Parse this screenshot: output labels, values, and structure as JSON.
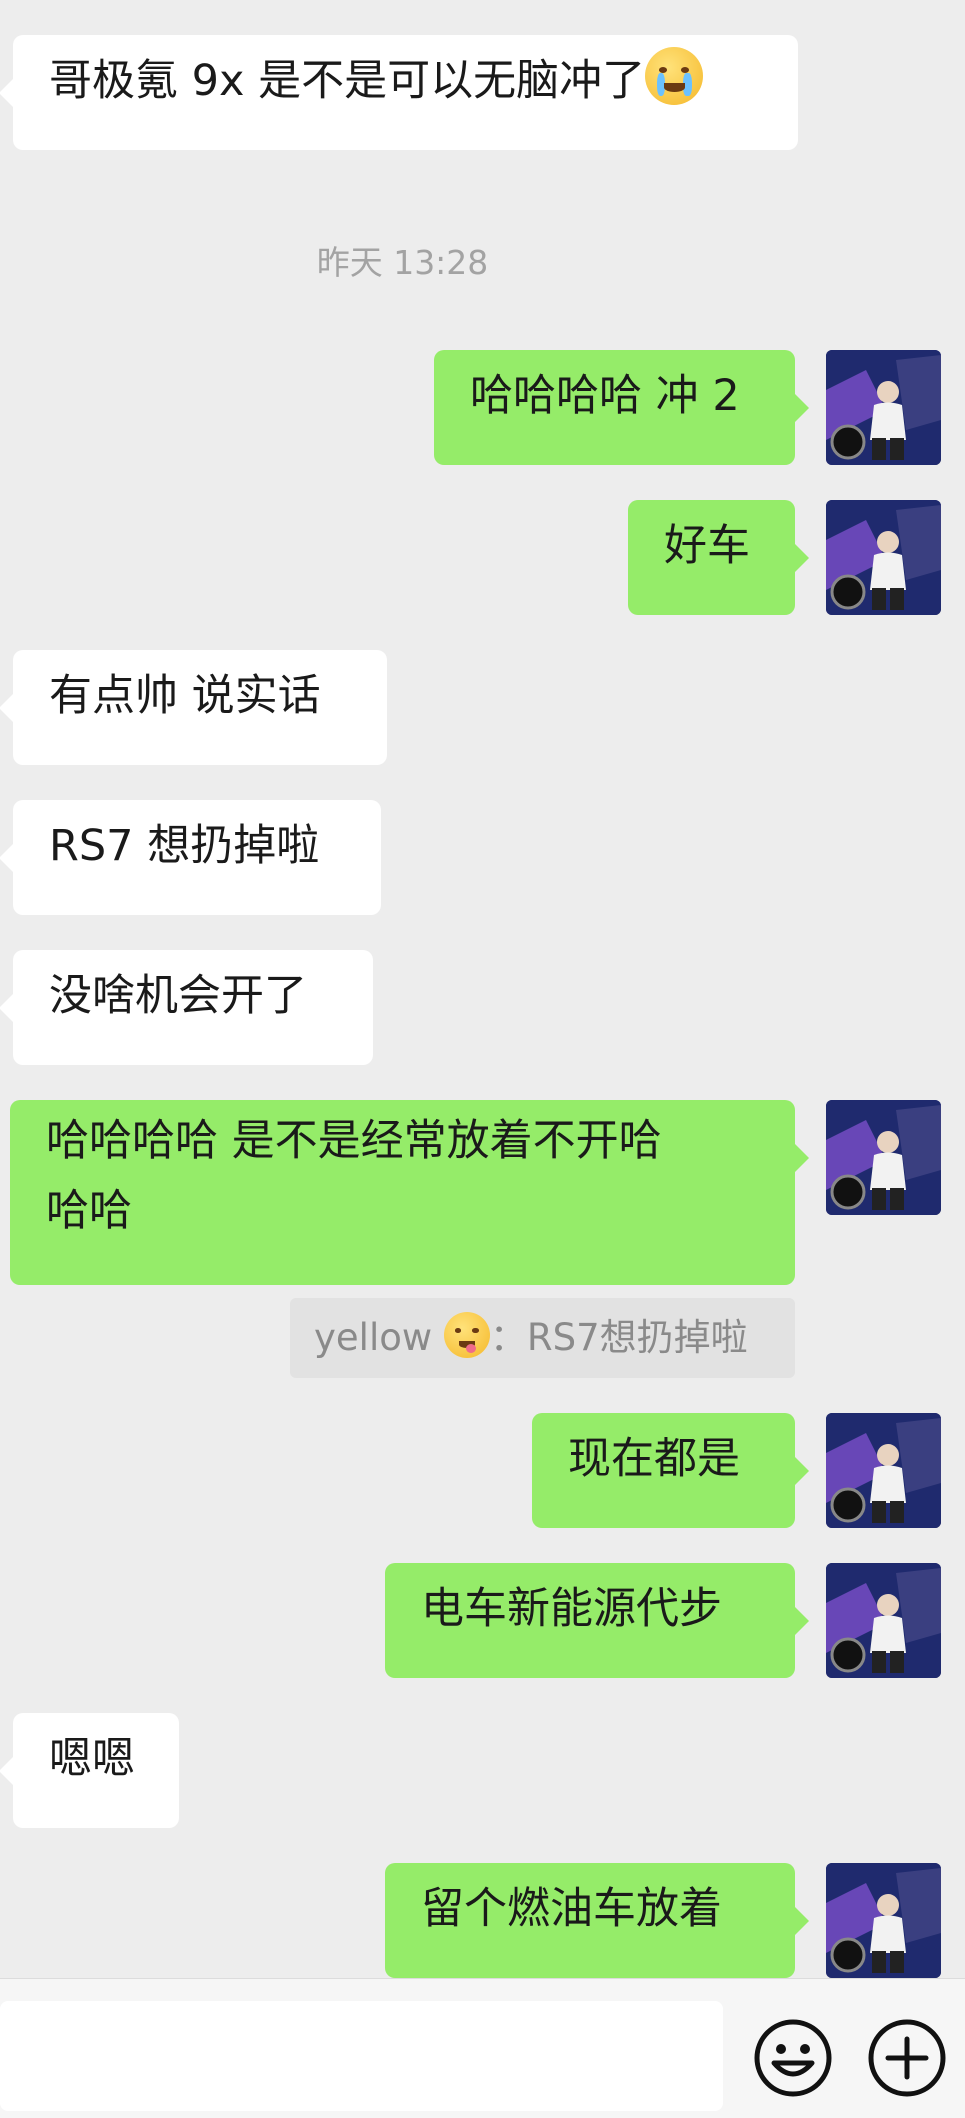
{
  "messages": {
    "m1": {
      "text": "哥极氪 9x 是不是可以无脑冲了"
    },
    "timestamp": "昨天 13:28",
    "m2": {
      "text": "哈哈哈哈 冲 2"
    },
    "m3": {
      "text": "好车"
    },
    "m4": {
      "text": "有点帅 说实话"
    },
    "m5": {
      "text": "RS7 想扔掉啦"
    },
    "m6": {
      "text": "没啥机会开了"
    },
    "m7": {
      "line1": "哈哈哈哈  是不是经常放着不开哈",
      "line2": "哈哈"
    },
    "quote": {
      "name": "yellow",
      "sep": "：",
      "text": "RS7想扔掉啦"
    },
    "m8": {
      "text": "现在都是"
    },
    "m9": {
      "text": "电车新能源代步"
    },
    "m10": {
      "text": "嗯嗯"
    },
    "m11": {
      "text": "留个燃油车放着"
    }
  },
  "icons": {
    "crying_emoji": "loudly-crying-face",
    "yum_emoji": "face-savoring-food",
    "emoji_button": "smiley-face-icon",
    "more_button": "plus-circle-icon"
  },
  "colors": {
    "background": "#ededed",
    "sent_bubble": "#95ec69",
    "received_bubble": "#ffffff"
  }
}
